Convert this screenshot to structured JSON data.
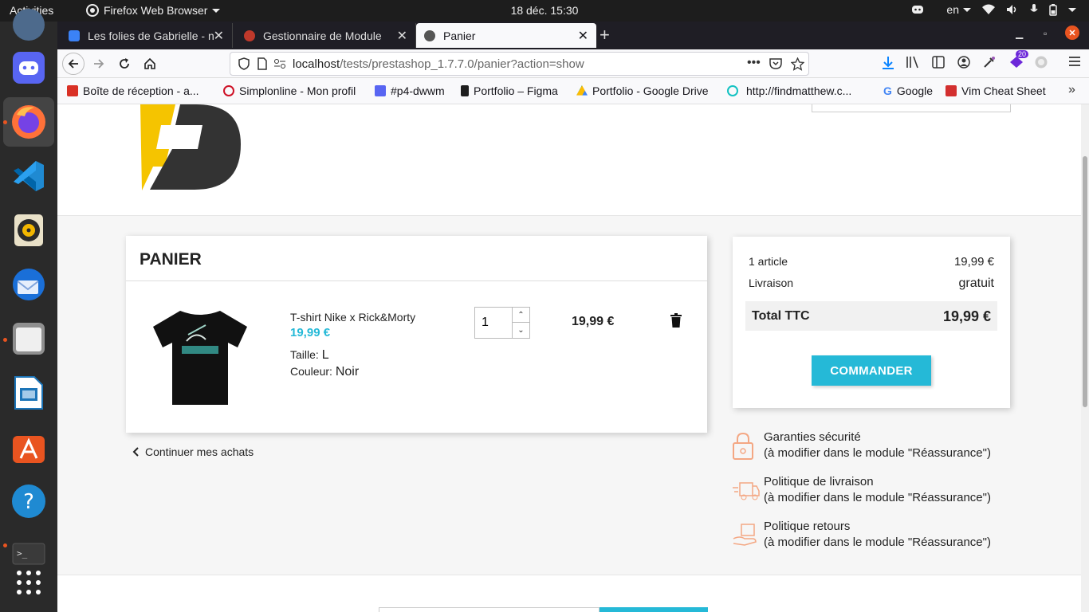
{
  "topbar": {
    "activities": "Activities",
    "app_name": "Firefox Web Browser",
    "clock": "18 déc.  15:30",
    "lang": "en"
  },
  "tabs": [
    {
      "title": "Les folies de Gabrielle - n",
      "active": false
    },
    {
      "title": "Gestionnaire de Module",
      "active": false
    },
    {
      "title": "Panier",
      "active": true
    }
  ],
  "navbar": {
    "url_host": "localhost",
    "url_path": "/tests/prestashop_1.7.7.0/panier?action=show",
    "ext_badge": "20"
  },
  "bookmarks": [
    {
      "label": "Boîte de réception - a...",
      "color": "#d93025"
    },
    {
      "label": "Simplonline - Mon profil",
      "color": "#ce1126"
    },
    {
      "label": "#p4-dwwm",
      "color": "#5865f2"
    },
    {
      "label": "Portfolio – Figma",
      "color": "#1e1e1e"
    },
    {
      "label": "Portfolio - Google Drive",
      "color": "#fbbc04"
    },
    {
      "label": "http://findmatthew.c...",
      "color": "#13c2c2"
    },
    {
      "label": "Google",
      "color": "#4285f4"
    },
    {
      "label": "Vim Cheat Sheet",
      "color": "#d32f2f"
    }
  ],
  "cart": {
    "title": "PANIER",
    "product": {
      "name": "T-shirt Nike x Rick&Morty",
      "price": "19,99 €",
      "size_label": "Taille:",
      "size_value": "L",
      "color_label": "Couleur:",
      "color_value": "Noir",
      "quantity": "1",
      "line_total": "19,99 €"
    },
    "continue": "Continuer mes achats"
  },
  "summary": {
    "items_label": "1 article",
    "items_value": "19,99 €",
    "shipping_label": "Livraison",
    "shipping_value": "gratuit",
    "total_label": "Total TTC",
    "total_value": "19,99 €",
    "order_button": "COMMANDER"
  },
  "reassurance": [
    {
      "title": "Garanties sécurité",
      "sub": "(à modifier dans le module \"Réassurance\")",
      "icon": "lock-icon"
    },
    {
      "title": "Politique de livraison",
      "sub": "(à modifier dans le module \"Réassurance\")",
      "icon": "delivery-truck-icon"
    },
    {
      "title": "Politique retours",
      "sub": "(à modifier dans le module \"Réassurance\")",
      "icon": "return-box-icon"
    }
  ],
  "colors": {
    "accent": "#25b9d7",
    "logo_yellow": "#f5c400",
    "logo_dark": "#333333"
  }
}
